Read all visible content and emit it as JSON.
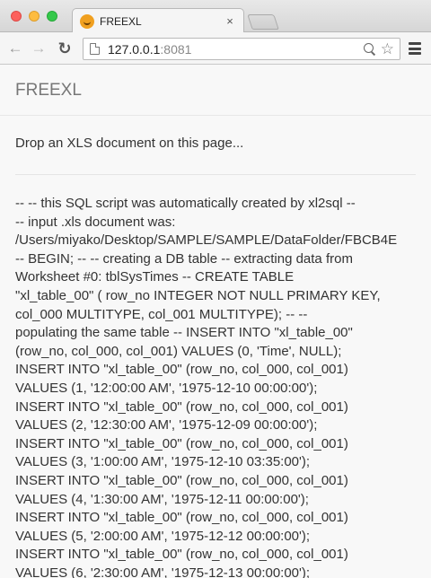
{
  "browser": {
    "tab": {
      "title": "FREEXL",
      "close": "×"
    },
    "url": {
      "host": "127.0.0.1",
      "port": ":8081"
    }
  },
  "app": {
    "brand": "FREEXL",
    "dropzone_text": "Drop an XLS document on this page..."
  },
  "sql_output": {
    "lines": [
      "-- -- this SQL script was automatically created by xl2sql --",
      "-- input .xls document was:",
      "/Users/miyako/Desktop/SAMPLE/SAMPLE/DataFolder/FBCB4E",
      "-- BEGIN; -- -- creating a DB table -- extracting data from",
      "Worksheet #0: tblSysTimes -- CREATE TABLE",
      "\"xl_table_00\" ( row_no INTEGER NOT NULL PRIMARY KEY,",
      "col_000 MULTITYPE, col_001 MULTITYPE); -- --",
      "populating the same table -- INSERT INTO \"xl_table_00\"",
      "(row_no, col_000, col_001) VALUES (0, 'Time', NULL);",
      "INSERT INTO \"xl_table_00\" (row_no, col_000, col_001)",
      "VALUES (1, '12:00:00 AM', '1975-12-10 00:00:00');",
      "INSERT INTO \"xl_table_00\" (row_no, col_000, col_001)",
      "VALUES (2, '12:30:00 AM', '1975-12-09 00:00:00');",
      "INSERT INTO \"xl_table_00\" (row_no, col_000, col_001)",
      "VALUES (3, '1:00:00 AM', '1975-12-10 03:35:00');",
      "INSERT INTO \"xl_table_00\" (row_no, col_000, col_001)",
      "VALUES (4, '1:30:00 AM', '1975-12-11 00:00:00');",
      "INSERT INTO \"xl_table_00\" (row_no, col_000, col_001)",
      "VALUES (5, '2:00:00 AM', '1975-12-12 00:00:00');",
      "INSERT INTO \"xl_table_00\" (row_no, col_000, col_001)",
      "VALUES (6, '2:30:00 AM', '1975-12-13 00:00:00');"
    ]
  }
}
